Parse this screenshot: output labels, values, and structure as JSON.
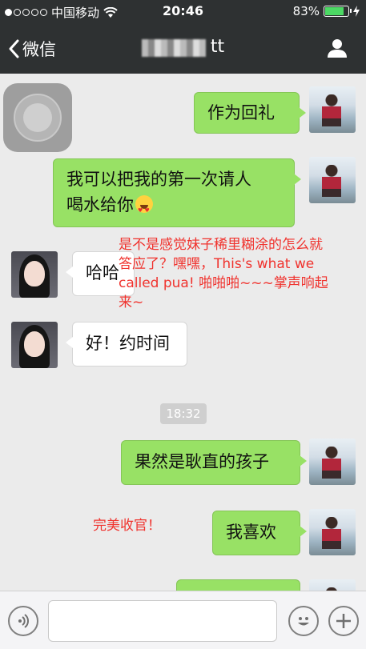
{
  "status_bar": {
    "carrier": "中国移动",
    "time": "20:46",
    "battery_percent": "83%",
    "battery_level": 0.83,
    "signal_bars_filled": 1,
    "signal_bars_total": 5
  },
  "nav": {
    "back_label": "微信",
    "title_suffix": "tt"
  },
  "messages": [
    {
      "side": "right",
      "text": "作为回礼"
    },
    {
      "side": "right",
      "text": "我可以把我的第一次请人",
      "text_line2": "喝水给你"
    },
    {
      "side": "left",
      "text": "哈哈"
    },
    {
      "side": "left",
      "text": "好！约时间"
    },
    {
      "side": "right",
      "text": "果然是耿直的孩子"
    },
    {
      "side": "right",
      "text": "我喜欢"
    }
  ],
  "timestamp": "18:32",
  "annotations": {
    "note1_line1": "是不是感觉妹子稀里糊涂的怎么就",
    "note1_line2": "答应了？嘿嘿，This's what we",
    "note1_line3": "called pua! 啪啪啪~~~掌声响起",
    "note1_line4": "来~",
    "note2": "完美收官！"
  },
  "colors": {
    "bar_bg": "#2e3132",
    "bubble_green": "#98e165",
    "annotation_red": "#f0332e"
  }
}
